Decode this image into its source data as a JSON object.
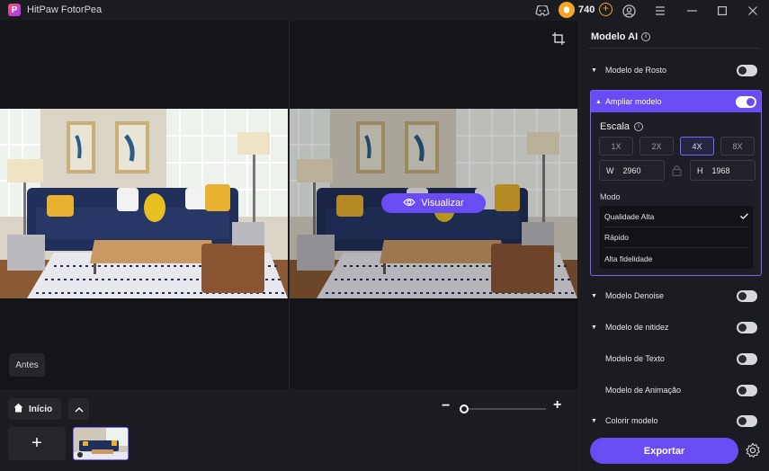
{
  "app": {
    "title": "HitPaw FotorPea",
    "credits": "740"
  },
  "canvas": {
    "preview_label": "Visualizar",
    "before_label": "Antes"
  },
  "bottom": {
    "home_label": "Início",
    "add_symbol": "+"
  },
  "panel": {
    "title": "Modelo AI",
    "models": {
      "rosto": "Modelo de Rosto",
      "ampliar": "Ampliar modelo",
      "denoise": "Modelo Denoise",
      "nitidez": "Modelo de nitidez",
      "texto": "Modelo de Texto",
      "animacao": "Modelo de Animação",
      "colorir": "Colorir modelo"
    },
    "ampliar": {
      "scale_label": "Escala",
      "scales": [
        "1X",
        "2X",
        "4X",
        "8X"
      ],
      "selected_scale": "4X",
      "width_label": "W",
      "width": "2960",
      "height_label": "H",
      "height": "1968",
      "mode_label": "Modo",
      "modes": [
        "Qualidade Alta",
        "Rápido",
        "Alta fidelidade"
      ],
      "selected_mode": "Qualidade Alta"
    },
    "export_label": "Exportar"
  },
  "toggles": {
    "rosto": false,
    "ampliar": true,
    "denoise": false,
    "nitidez": false,
    "texto": false,
    "animacao": false,
    "colorir": false
  },
  "colors": {
    "accent": "#6a4cf5",
    "coin": "#f5a623",
    "panel_bg": "#1b1c21"
  }
}
